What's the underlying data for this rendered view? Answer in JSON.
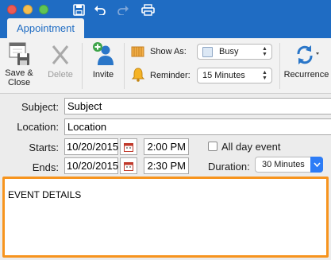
{
  "window": {
    "traffic_lights": [
      "close",
      "minimize",
      "zoom"
    ],
    "quick_access": [
      "save-icon",
      "undo-icon",
      "redo-icon",
      "print-icon"
    ]
  },
  "tabs": {
    "active": "Appointment"
  },
  "ribbon": {
    "save_close": "Save &\nClose",
    "delete": "Delete",
    "invite": "Invite",
    "show_as_label": "Show As:",
    "show_as_value": "Busy",
    "reminder_label": "Reminder:",
    "reminder_value": "15 Minutes",
    "recurrence": "Recurrence"
  },
  "form": {
    "subject_label": "Subject:",
    "subject_value": "Subject",
    "location_label": "Location:",
    "location_value": "Location",
    "starts_label": "Starts:",
    "start_date": "10/20/2015",
    "start_time": "2:00 PM",
    "all_day_label": "All day event",
    "all_day_checked": false,
    "ends_label": "Ends:",
    "end_date": "10/20/2015",
    "end_time": "2:30 PM",
    "duration_label": "Duration:",
    "duration_value": "30 Minutes"
  },
  "body": {
    "text": "EVENT DETAILS"
  },
  "colors": {
    "titlebar": "#1f6cc3",
    "highlight_border": "#f7941e",
    "select_accent": "#2d7cf6"
  }
}
